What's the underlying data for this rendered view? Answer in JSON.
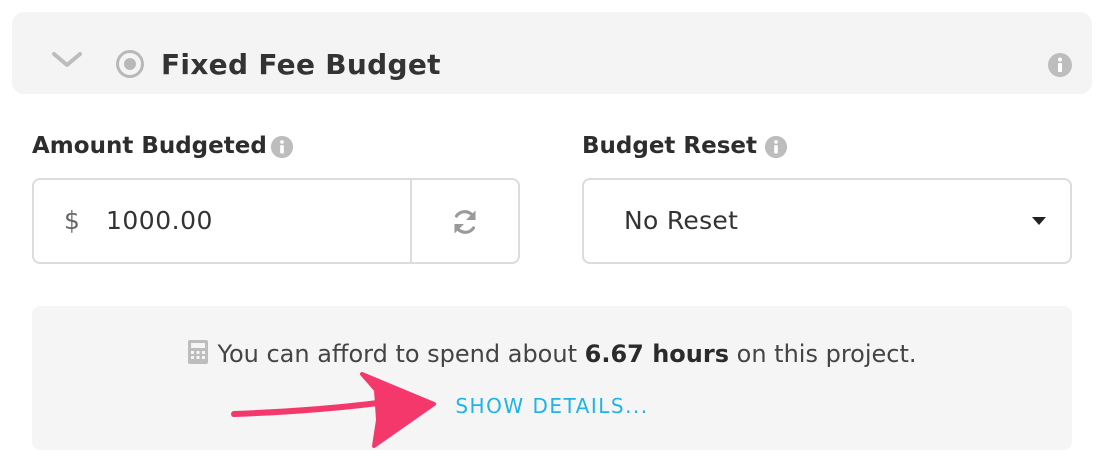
{
  "header": {
    "title": "Fixed Fee Budget",
    "icons": [
      "chevron-down-icon",
      "target-icon",
      "info-icon"
    ]
  },
  "amount": {
    "label": "Amount Budgeted",
    "currency_symbol": "$",
    "value": "1000.00"
  },
  "reset": {
    "label": "Budget Reset",
    "selected": "No Reset"
  },
  "summary": {
    "prefix": "You can afford to spend about",
    "hours": "6.67 hours",
    "suffix": "on this project.",
    "link": "SHOW DETAILS..."
  },
  "colors": {
    "link": "#1fb3e6",
    "arrow": "#f5386b",
    "panel": "#f5f5f5"
  }
}
